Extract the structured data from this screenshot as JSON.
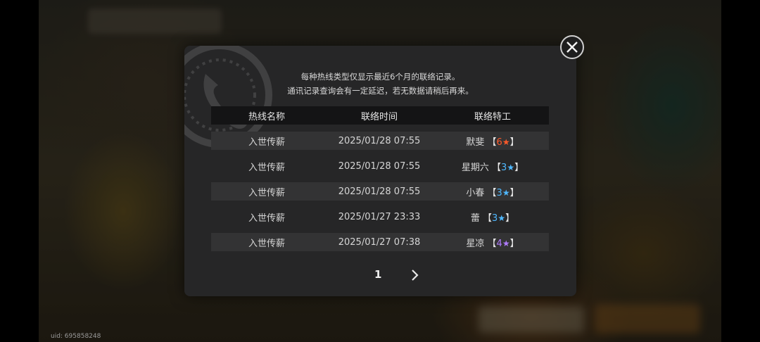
{
  "footer": {
    "uid": "uid: 695858248"
  },
  "dialog": {
    "notice_line1": "每种热线类型仅显示最近6个月的联络记录。",
    "notice_line2": "通讯记录查询会有一定延迟，若无数据请稍后再来。",
    "columns": [
      "热线名称",
      "联络时间",
      "联络特工"
    ],
    "rows": [
      {
        "hotline": "入世传薪",
        "time": "2025/01/28 07:55",
        "agent": "默斐",
        "rank": "6",
        "rank_color": "#ff5a2a"
      },
      {
        "hotline": "入世传薪",
        "time": "2025/01/28 07:55",
        "agent": "星期六",
        "rank": "3",
        "rank_color": "#4fb8ff"
      },
      {
        "hotline": "入世传薪",
        "time": "2025/01/28 07:55",
        "agent": "小春",
        "rank": "3",
        "rank_color": "#4fb8ff"
      },
      {
        "hotline": "入世传薪",
        "time": "2025/01/27 23:33",
        "agent": "蕾",
        "rank": "3",
        "rank_color": "#4fb8ff"
      },
      {
        "hotline": "入世传薪",
        "time": "2025/01/27 07:38",
        "agent": "星凉",
        "rank": "4",
        "rank_color": "#b07cff"
      }
    ],
    "pagination": {
      "current_page": "1"
    }
  },
  "icons": {
    "close": "close-icon",
    "next": "chevron-right-icon",
    "star": "star-icon",
    "emblem": "phone-emblem-icon"
  }
}
